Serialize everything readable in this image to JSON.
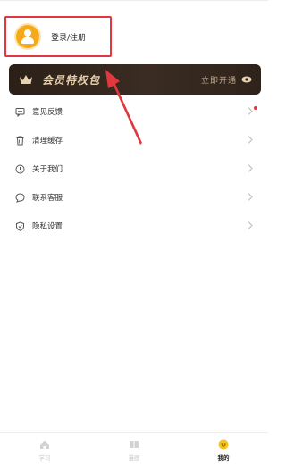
{
  "login": {
    "label": "登录/注册",
    "avatar_color": "#f6a91c"
  },
  "vip": {
    "title": "会员特权包",
    "action": "立即开通"
  },
  "menu": [
    {
      "label": "意见反馈",
      "icon": "feedback-icon",
      "badge_dot": true
    },
    {
      "label": "清理缓存",
      "icon": "trash-icon",
      "badge_dot": false
    },
    {
      "label": "关于我们",
      "icon": "info-icon",
      "badge_dot": false
    },
    {
      "label": "联系客服",
      "icon": "chat-icon",
      "badge_dot": false
    },
    {
      "label": "隐私设置",
      "icon": "shield-icon",
      "badge_dot": false
    }
  ],
  "tabs": [
    {
      "label": "学习",
      "icon": "home-icon",
      "active": false
    },
    {
      "label": "漫画",
      "icon": "book-icon",
      "active": false
    },
    {
      "label": "我的",
      "icon": "profile-icon",
      "active": true
    }
  ],
  "colors": {
    "annotation": "#e0383e",
    "vip_bg": "#2b2018",
    "vip_text": "#e9d2b0"
  }
}
